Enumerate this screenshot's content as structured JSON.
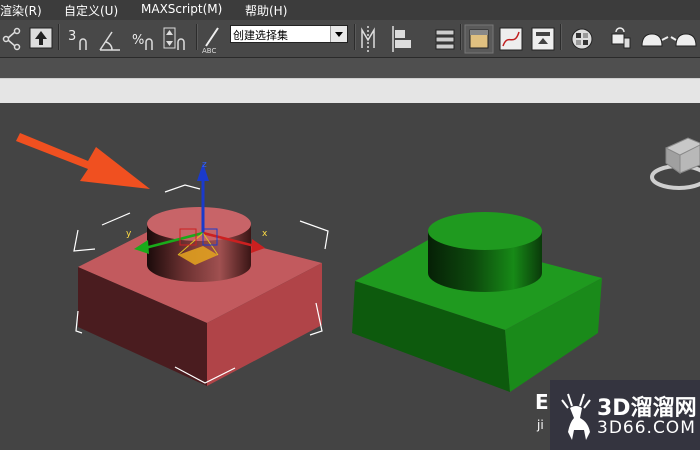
{
  "menu": {
    "items": [
      "渲染(R)",
      "自定义(U)",
      "MAXScript(M)",
      "帮助(H)"
    ]
  },
  "toolbar": {
    "selection_set": "创建选择集",
    "snap_label": "3"
  },
  "viewport": {
    "gizmo_axes": {
      "x": "x",
      "y": "y",
      "z": "z"
    }
  },
  "watermark": {
    "brand": "3D溜溜网",
    "url": "3D66.COM",
    "partial_left": "E",
    "partial_left_sub": "ji"
  },
  "colors": {
    "red_box": "#c0555a",
    "green_box": "#1f9a1f",
    "arrow": "#f05020",
    "menubar": "#3c3c3c"
  }
}
